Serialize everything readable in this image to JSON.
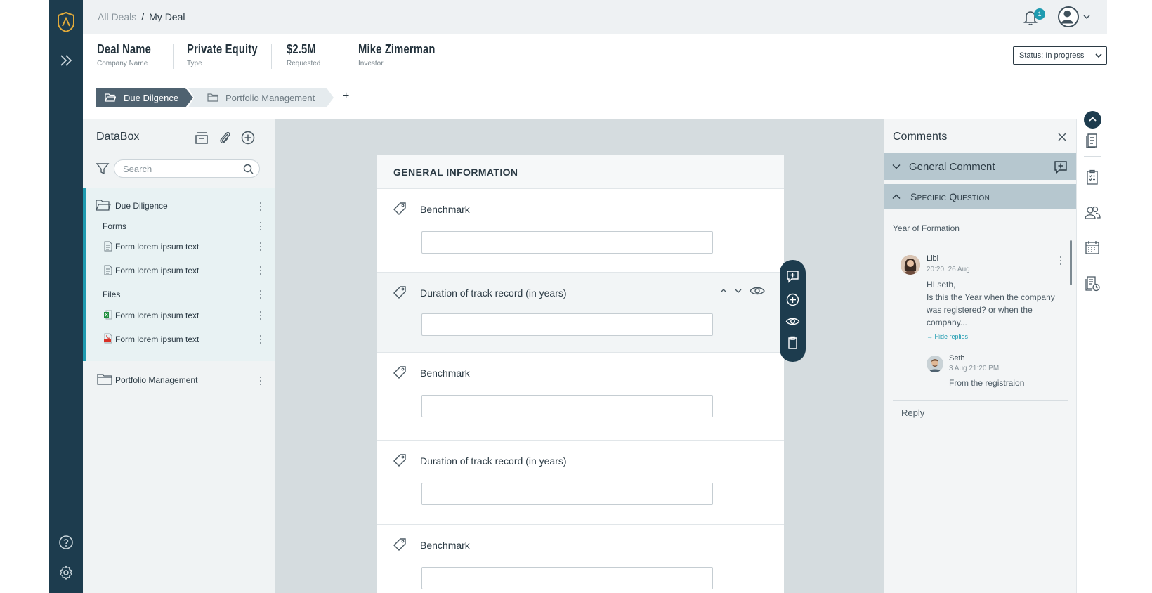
{
  "breadcrumb": {
    "root": "All Deals",
    "separator": "/",
    "current": "My Deal"
  },
  "notifications": {
    "count": "1"
  },
  "deal": {
    "fields": [
      {
        "value": "Deal Name",
        "label": "Company Name"
      },
      {
        "value": "Private Equity",
        "label": "Type"
      },
      {
        "value": "$2.5M",
        "label": "Requested"
      },
      {
        "value": "Mike Zimerman",
        "label": "Investor"
      }
    ],
    "status": "Status: In progress"
  },
  "tabs": {
    "active": "Due Dilgence",
    "inactive": "Portfolio Management",
    "add": "+"
  },
  "databox": {
    "title": "DataBox",
    "search_placeholder": "Search",
    "tree": {
      "due_diligence": "Due Diligence",
      "forms": "Forms",
      "form1": "Form lorem ipsum text",
      "form2": "Form lorem ipsum text",
      "files": "Files",
      "file1": "Form lorem ipsum text",
      "file2": "Form lorem ipsum text",
      "portfolio": "Portfolio Management"
    }
  },
  "form": {
    "heading": "GENERAL INFORMATION",
    "questions": [
      {
        "label": "Benchmark"
      },
      {
        "label": "Duration of track record (in years)"
      },
      {
        "label": "Benchmark"
      },
      {
        "label": "Duration of track record (in years)"
      },
      {
        "label": "Benchmark"
      }
    ]
  },
  "comments": {
    "title": "Comments",
    "general": "General Comment",
    "specific": "Specific Question",
    "question_title": "Year of Formation",
    "thread": {
      "author": "Libi",
      "time": "20:20, 26 Aug",
      "body1": "HI seth,",
      "body2": "Is this the Year when the company",
      "body3": "was  registered? or when the",
      "body4": "company...",
      "hide_replies": "Hide replies",
      "reply_author": "Seth",
      "reply_time": "3 Aug 21:20 PM",
      "reply_body": "From the registraion"
    },
    "reply": "Reply"
  },
  "colors": {
    "nav": "#1d3c4e",
    "accent": "#1e9bb0",
    "tab_active": "#4f6270",
    "panel_header": "#b6c7cf"
  }
}
